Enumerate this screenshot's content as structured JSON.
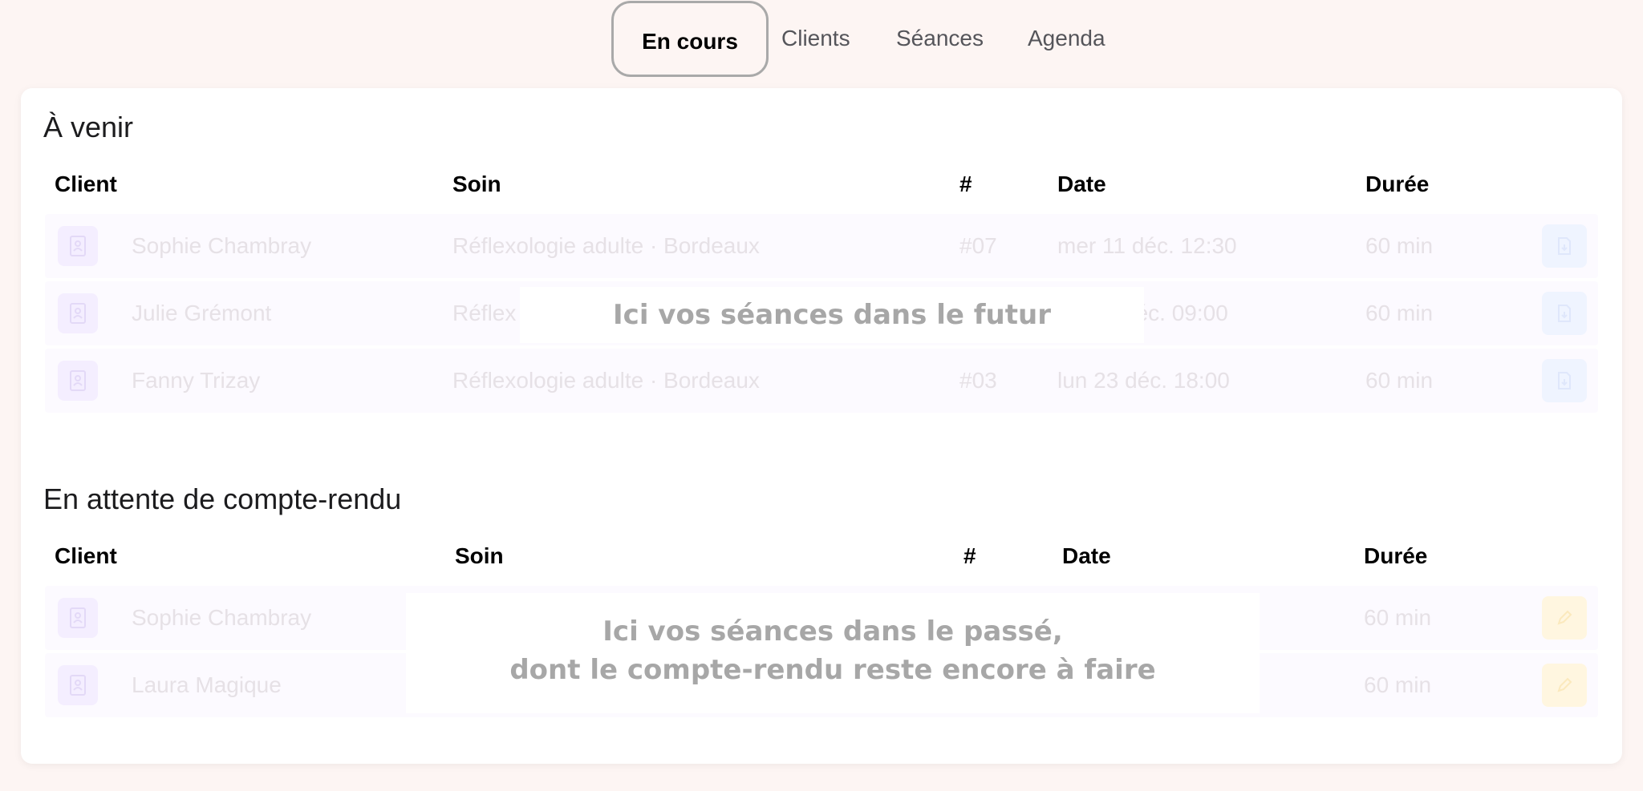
{
  "nav": {
    "tabs": [
      {
        "label": "En cours",
        "active": true
      },
      {
        "label": "Clients",
        "active": false
      },
      {
        "label": "Séances",
        "active": false
      },
      {
        "label": "Agenda",
        "active": false
      }
    ]
  },
  "upcoming": {
    "title": "À venir",
    "columns": {
      "client": "Client",
      "soin": "Soin",
      "num": "#",
      "date": "Date",
      "duree": "Durée"
    },
    "rows": [
      {
        "client": "Sophie Chambray",
        "soin": "Réflexologie adulte · Bordeaux",
        "num": "#07",
        "date": "mer 11 déc. 12:30",
        "duree": "60 min"
      },
      {
        "client": "Julie Grémont",
        "soin": "Réflex",
        "num": "",
        "date": "déc. 09:00",
        "duree": "60 min"
      },
      {
        "client": "Fanny Trizay",
        "soin": "Réflexologie adulte · Bordeaux",
        "num": "#03",
        "date": "lun 23 déc. 18:00",
        "duree": "60 min"
      }
    ],
    "overlay": "Ici vos séances dans le futur"
  },
  "pending": {
    "title": "En attente de compte-rendu",
    "columns": {
      "client": "Client",
      "soin": "Soin",
      "num": "#",
      "date": "Date",
      "duree": "Durée"
    },
    "rows": [
      {
        "client": "Sophie Chambray",
        "duree": "60 min"
      },
      {
        "client": "Laura Magique",
        "duree": "60 min"
      }
    ],
    "overlay_line1": "Ici vos séances dans le passé,",
    "overlay_line2": "dont le compte-rendu reste encore à faire"
  },
  "icons": {
    "client_icon": "contact-card-icon",
    "upcoming_action": "document-icon",
    "pending_action": "pencil-icon"
  },
  "colors": {
    "background": "#fdf5f3",
    "active_tab_border": "#a9a9a9",
    "overlay_text": "#a7a7a7",
    "client_icon_bg": "#f4eeff",
    "doc_action_bg": "#eff4ff",
    "edit_action_bg": "#fff6e0"
  }
}
